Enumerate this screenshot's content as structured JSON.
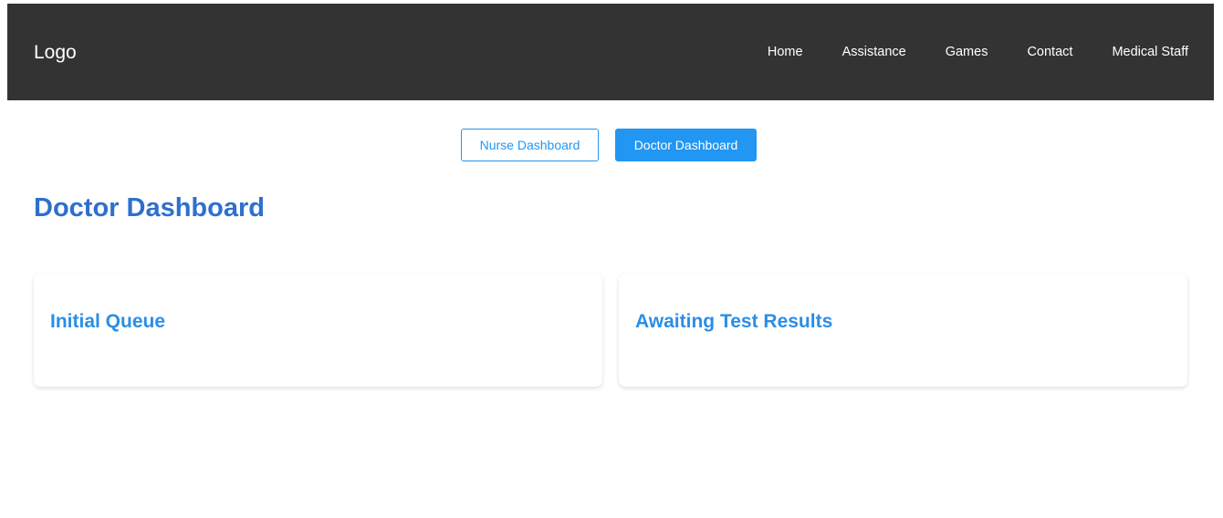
{
  "header": {
    "logo": "Logo",
    "nav": [
      {
        "label": "Home"
      },
      {
        "label": "Assistance"
      },
      {
        "label": "Games"
      },
      {
        "label": "Contact"
      },
      {
        "label": "Medical Staff"
      }
    ]
  },
  "switcher": {
    "nurse_label": "Nurse Dashboard",
    "doctor_label": "Doctor Dashboard",
    "active": "Doctor Dashboard"
  },
  "main": {
    "title": "Doctor Dashboard",
    "cards": [
      {
        "title": "Initial Queue"
      },
      {
        "title": "Awaiting Test Results"
      }
    ]
  },
  "colors": {
    "navbar": "#333333",
    "accent": "#2196f3",
    "title": "#2e6fce"
  }
}
